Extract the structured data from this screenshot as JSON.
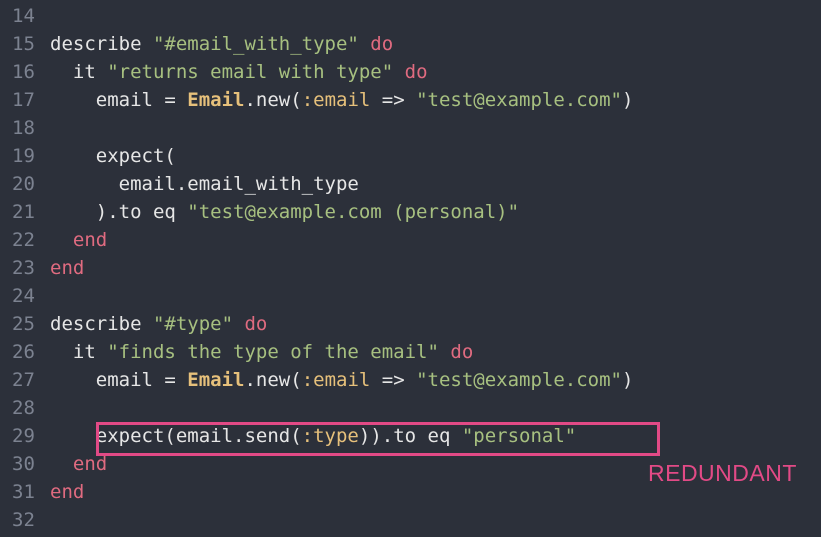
{
  "lines": [
    {
      "n": "14",
      "tokens": []
    },
    {
      "n": "15",
      "tokens": [
        {
          "t": "txt",
          "v": "describe "
        },
        {
          "t": "str",
          "v": "\"#email_with_type\""
        },
        {
          "t": "kw",
          "v": " do"
        }
      ]
    },
    {
      "n": "16",
      "tokens": [
        {
          "t": "txt",
          "v": "  it "
        },
        {
          "t": "str",
          "v": "\"returns email with type\""
        },
        {
          "t": "kw",
          "v": " do"
        }
      ]
    },
    {
      "n": "17",
      "tokens": [
        {
          "t": "txt",
          "v": "    email = "
        },
        {
          "t": "const",
          "v": "Email"
        },
        {
          "t": "txt",
          "v": ".new("
        },
        {
          "t": "sym",
          "v": ":email"
        },
        {
          "t": "txt",
          "v": " => "
        },
        {
          "t": "str",
          "v": "\"test@example.com\""
        },
        {
          "t": "txt",
          "v": ")"
        }
      ]
    },
    {
      "n": "18",
      "tokens": []
    },
    {
      "n": "19",
      "tokens": [
        {
          "t": "txt",
          "v": "    expect("
        }
      ]
    },
    {
      "n": "20",
      "tokens": [
        {
          "t": "txt",
          "v": "      email.email_with_type"
        }
      ]
    },
    {
      "n": "21",
      "tokens": [
        {
          "t": "txt",
          "v": "    ).to eq "
        },
        {
          "t": "str",
          "v": "\"test@example.com (personal)\""
        }
      ]
    },
    {
      "n": "22",
      "tokens": [
        {
          "t": "kw",
          "v": "  end"
        }
      ]
    },
    {
      "n": "23",
      "tokens": [
        {
          "t": "kw",
          "v": "end"
        }
      ]
    },
    {
      "n": "24",
      "tokens": []
    },
    {
      "n": "25",
      "tokens": [
        {
          "t": "txt",
          "v": "describe "
        },
        {
          "t": "str",
          "v": "\"#type\""
        },
        {
          "t": "kw",
          "v": " do"
        }
      ]
    },
    {
      "n": "26",
      "tokens": [
        {
          "t": "txt",
          "v": "  it "
        },
        {
          "t": "str",
          "v": "\"finds the type of the email\""
        },
        {
          "t": "kw",
          "v": " do"
        }
      ]
    },
    {
      "n": "27",
      "tokens": [
        {
          "t": "txt",
          "v": "    email = "
        },
        {
          "t": "const",
          "v": "Email"
        },
        {
          "t": "txt",
          "v": ".new("
        },
        {
          "t": "sym",
          "v": ":email"
        },
        {
          "t": "txt",
          "v": " => "
        },
        {
          "t": "str",
          "v": "\"test@example.com\""
        },
        {
          "t": "txt",
          "v": ")"
        }
      ]
    },
    {
      "n": "28",
      "tokens": []
    },
    {
      "n": "29",
      "tokens": [
        {
          "t": "txt",
          "v": "    expect(email.send("
        },
        {
          "t": "sym",
          "v": ":type"
        },
        {
          "t": "txt",
          "v": ")).to eq "
        },
        {
          "t": "str",
          "v": "\"personal\""
        }
      ]
    },
    {
      "n": "30",
      "tokens": [
        {
          "t": "kw",
          "v": "  end"
        }
      ]
    },
    {
      "n": "31",
      "tokens": [
        {
          "t": "kw",
          "v": "end"
        }
      ]
    },
    {
      "n": "32",
      "tokens": []
    }
  ],
  "annotation": {
    "label": "REDUNDANT",
    "color": "#e24a86"
  },
  "colors": {
    "background": "#2c303a",
    "keyword": "#e06b80",
    "string": "#a7c080",
    "symbol": "#e6c07b",
    "line_number": "#7c8290"
  }
}
